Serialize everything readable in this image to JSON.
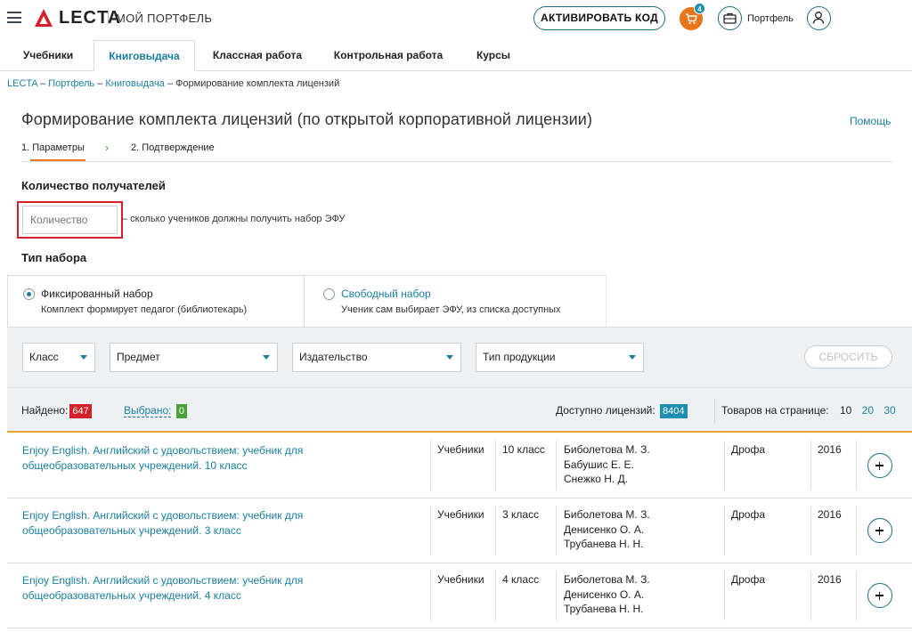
{
  "header": {
    "logo": "LECTA",
    "section": "МОЙ ПОРТФЕЛЬ",
    "activate_label": "АКТИВИРОВАТЬ КОД",
    "cart_count": "4",
    "portfolio_label": "Портфель",
    "brand_color": "#d4202b",
    "accent_color": "#1a7fa0"
  },
  "tabs": [
    {
      "label": "Учебники"
    },
    {
      "label": "Книговыдача",
      "active": true
    },
    {
      "label": "Классная работа"
    },
    {
      "label": "Контрольная работа"
    },
    {
      "label": "Курсы"
    }
  ],
  "breadcrumb": {
    "items": [
      "LECTA",
      "Портфель",
      "Книговыдача"
    ],
    "current": "Формирование комплекта лицензий",
    "sep": " – "
  },
  "page": {
    "title": "Формирование комплекта лицензий (по открытой корпоративной лицензии)",
    "help": "Помощь"
  },
  "steps": {
    "step1": "1. Параметры",
    "step2": "2. Подтверждение"
  },
  "recipients": {
    "heading": "Количество получателей",
    "placeholder": "Количество",
    "hint": "– сколько учеников должны получить набор ЭФУ"
  },
  "set_type": {
    "heading": "Тип набора",
    "fixed_title": "Фиксированный набор",
    "fixed_sub": "Комплект формирует педагог (библиотекарь)",
    "free_title": "Свободный набор",
    "free_sub": "Ученик сам выбирает ЭФУ, из списка доступных"
  },
  "filters": {
    "class": "Класс",
    "subject": "Предмет",
    "publisher": "Издательство",
    "product_type": "Тип продукции",
    "reset": "СБРОСИТЬ"
  },
  "stats": {
    "found_label": "Найдено:",
    "found_count": "647",
    "selected_label": "Выбрано:",
    "selected_count": "0",
    "available_label": "Доступно лицензий:",
    "available_count": "8404",
    "per_page_label": "Товаров на странице:",
    "per_page": [
      "10",
      "20",
      "30"
    ]
  },
  "rows": [
    {
      "title": "Enjoy English. Английский с удовольствием: учебник для общеобразовательных учреждений. 10 класс",
      "type": "Учебники",
      "grade": "10 класс",
      "authors": [
        "Биболетова М. З.",
        "Бабушис Е. Е.",
        "Снежко Н. Д."
      ],
      "publisher": "Дрофа",
      "year": "2016"
    },
    {
      "title": "Enjoy English. Английский с удовольствием: учебник для общеобразовательных учреждений. 3 класс",
      "type": "Учебники",
      "grade": "3 класс",
      "authors": [
        "Биболетова М. З.",
        "Денисенко О. А.",
        "Трубанева Н. Н."
      ],
      "publisher": "Дрофа",
      "year": "2016"
    },
    {
      "title": "Enjoy English. Английский с удовольствием: учебник для общеобразовательных учреждений. 4 класс",
      "type": "Учебники",
      "grade": "4 класс",
      "authors": [
        "Биболетова М. З.",
        "Денисенко О. А.",
        "Трубанева Н. Н."
      ],
      "publisher": "Дрофа",
      "year": "2016"
    }
  ]
}
